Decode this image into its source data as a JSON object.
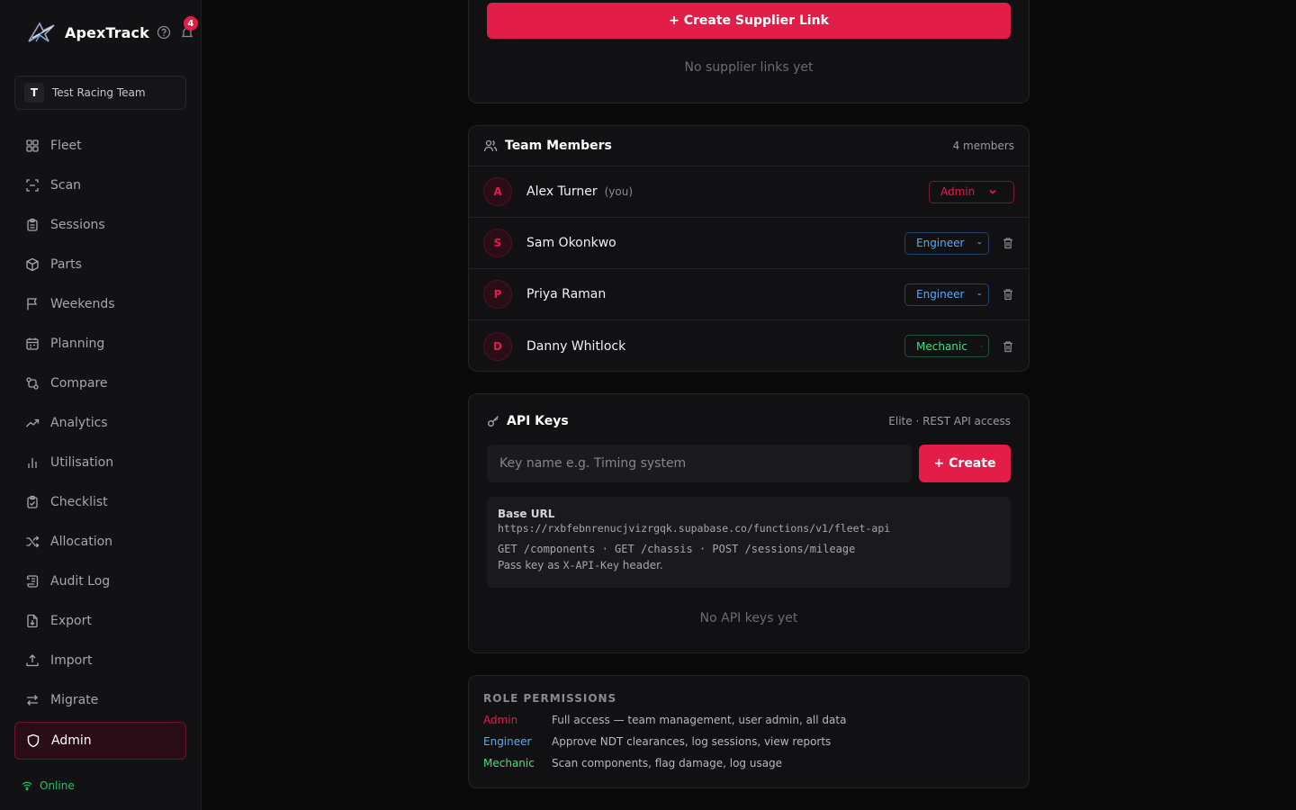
{
  "brand": {
    "name": "ApexTrack",
    "notification_count": "4"
  },
  "team": {
    "initial": "T",
    "name": "Test Racing Team"
  },
  "nav": {
    "items": [
      {
        "label": "Fleet",
        "icon": "grid-icon"
      },
      {
        "label": "Scan",
        "icon": "scan-icon"
      },
      {
        "label": "Sessions",
        "icon": "clipboard-icon"
      },
      {
        "label": "Parts",
        "icon": "box-icon"
      },
      {
        "label": "Weekends",
        "icon": "flag-icon"
      },
      {
        "label": "Planning",
        "icon": "calendar-icon"
      },
      {
        "label": "Compare",
        "icon": "compare-icon"
      },
      {
        "label": "Analytics",
        "icon": "trend-icon"
      },
      {
        "label": "Utilisation",
        "icon": "bar-chart-icon"
      },
      {
        "label": "Checklist",
        "icon": "clipboard-check-icon"
      },
      {
        "label": "Allocation",
        "icon": "shuffle-icon"
      },
      {
        "label": "Audit Log",
        "icon": "scroll-icon"
      },
      {
        "label": "Export",
        "icon": "file-export-icon"
      },
      {
        "label": "Import",
        "icon": "upload-icon"
      },
      {
        "label": "Migrate",
        "icon": "swap-icon"
      },
      {
        "label": "Admin",
        "icon": "shield-icon",
        "active": true
      }
    ]
  },
  "status": {
    "label": "Online",
    "color": "#22c55e"
  },
  "supplier": {
    "create_label": "+ Create Supplier Link",
    "empty": "No supplier links yet"
  },
  "members": {
    "title": "Team Members",
    "count_label": "4 members",
    "list": [
      {
        "initial": "A",
        "name": "Alex Turner",
        "you": "(you)",
        "role": "Admin"
      },
      {
        "initial": "S",
        "name": "Sam Okonkwo",
        "role": "Engineer"
      },
      {
        "initial": "P",
        "name": "Priya Raman",
        "role": "Engineer"
      },
      {
        "initial": "D",
        "name": "Danny Whitlock",
        "role": "Mechanic"
      }
    ]
  },
  "api": {
    "title": "API Keys",
    "meta": "Elite · REST API access",
    "placeholder": "Key name e.g. Timing system",
    "create_label": "+ Create",
    "base_url_title": "Base URL",
    "base_url": "https://rxbfebnrenucjvizrgqk.supabase.co/functions/v1/fleet-api",
    "endpoints": "GET /components · GET /chassis · POST /sessions/mileage",
    "note_prefix": "Pass key as ",
    "note_code": "X-API-Key",
    "note_suffix": " header.",
    "empty": "No API keys yet"
  },
  "permissions": {
    "title": "ROLE PERMISSIONS",
    "rows": [
      {
        "role": "Admin",
        "desc": "Full access — team management, user admin, all data"
      },
      {
        "role": "Engineer",
        "desc": "Approve NDT clearances, log sessions, view reports"
      },
      {
        "role": "Mechanic",
        "desc": "Scan components, flag damage, log usage"
      }
    ]
  },
  "colors": {
    "accent": "#e11d48",
    "engineer": "#60a5fa",
    "mechanic": "#4ade80",
    "background": "#0a0a0b"
  }
}
